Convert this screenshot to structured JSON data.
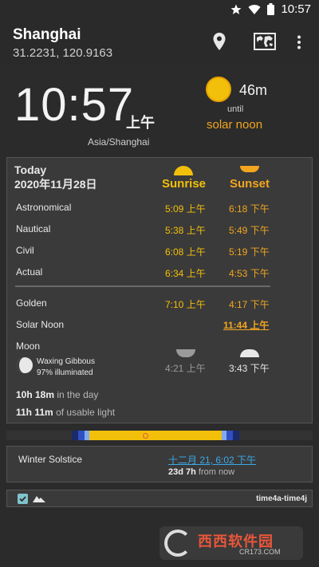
{
  "status_bar": {
    "time": "10:57",
    "icons": [
      "star-icon",
      "wifi-icon",
      "battery-icon"
    ]
  },
  "app_bar": {
    "city": "Shanghai",
    "coordinates": "31.2231, 120.9163",
    "actions": [
      "location-pin-icon",
      "world-map-icon",
      "overflow-menu-icon"
    ]
  },
  "clock": {
    "time": "10:57",
    "ampm": "上午",
    "timezone": "Asia/Shanghai",
    "next_event_minutes": "46m",
    "until_label": "until",
    "next_event": "solar noon"
  },
  "card": {
    "today_label": "Today",
    "date": "2020年11月28日",
    "sunrise_label": "Sunrise",
    "sunset_label": "Sunset",
    "rows": [
      {
        "label": "Astronomical",
        "rise": "5:09 上午",
        "set": "6:18 下午"
      },
      {
        "label": "Nautical",
        "rise": "5:38 上午",
        "set": "5:49 下午"
      },
      {
        "label": "Civil",
        "rise": "6:08 上午",
        "set": "5:19 下午"
      },
      {
        "label": "Actual",
        "rise": "6:34 上午",
        "set": "4:53 下午"
      },
      {
        "label": "Golden",
        "rise": "7:10 上午",
        "set": "4:17 下午"
      }
    ],
    "solar_noon": {
      "label": "Solar Noon",
      "time": "11:44 上午"
    },
    "moon": {
      "label": "Moon",
      "phase": "Waxing Gibbous",
      "illumination": "97% illuminated",
      "rise": "4:21 上午",
      "set": "3:43 下午"
    },
    "day_length": {
      "value": "10h 18m",
      "suffix": "in the day"
    },
    "usable_light": {
      "value": "11h 11m",
      "suffix": "of usable light"
    }
  },
  "solstice": {
    "label": "Winter Solstice",
    "date": "十二月 21, 6:02 下午",
    "countdown": "23d 7h",
    "countdown_suffix": "from now"
  },
  "footer": {
    "label": "time4a-time4j"
  },
  "watermark": {
    "text": "西西软件园",
    "url": "CR173.COM"
  },
  "colors": {
    "accent_sun": "#f2c00a",
    "accent_sunset": "#f2a620",
    "link_blue": "#3aa8e8",
    "background": "#2b2b2b",
    "card": "#3a3a3a"
  }
}
